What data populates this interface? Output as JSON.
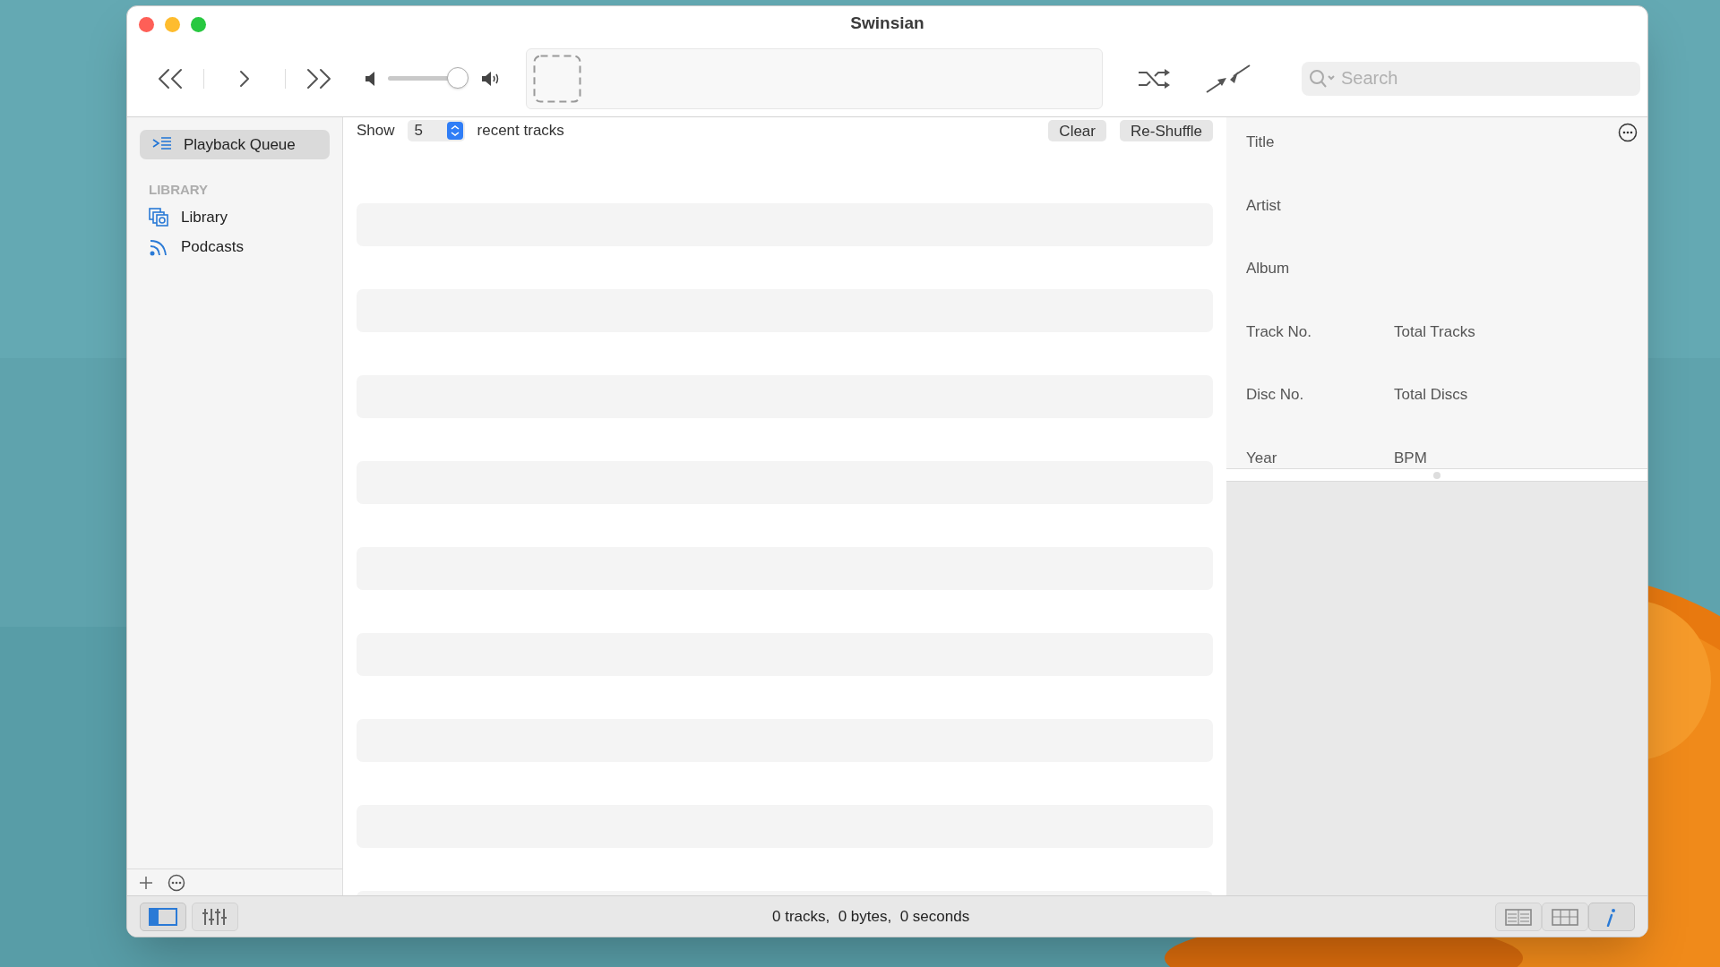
{
  "window": {
    "title": "Swinsian"
  },
  "toolbar": {
    "volume": {
      "level": 0.95
    },
    "search": {
      "placeholder": "Search"
    }
  },
  "sidebar": {
    "items": [
      {
        "label": "Playback Queue",
        "kind": "queue",
        "selected": true
      }
    ],
    "sections": [
      {
        "header": "LIBRARY",
        "items": [
          {
            "label": "Library",
            "kind": "library",
            "selected": false
          },
          {
            "label": "Podcasts",
            "kind": "podcasts",
            "selected": false
          }
        ]
      }
    ]
  },
  "queue": {
    "show_label": "Show",
    "count": "5",
    "suffix": "recent tracks",
    "buttons": [
      "Clear",
      "Re-Shuffle"
    ]
  },
  "info": {
    "fields": [
      [
        "Title"
      ],
      [
        "Artist"
      ],
      [
        "Album"
      ],
      [
        "Track No.",
        "Total Tracks"
      ],
      [
        "Disc No.",
        "Total Discs"
      ],
      [
        "Year",
        "BPM"
      ]
    ]
  },
  "status_bar": {
    "text": "0 tracks,  0 bytes,  0 seconds",
    "left_buttons": [
      {
        "kind": "sidebar",
        "selected": true
      },
      {
        "kind": "equalizer",
        "selected": false
      }
    ],
    "right_buttons": [
      {
        "kind": "columns",
        "selected": false
      },
      {
        "kind": "grid",
        "selected": false
      },
      {
        "kind": "info",
        "selected": true
      }
    ]
  }
}
